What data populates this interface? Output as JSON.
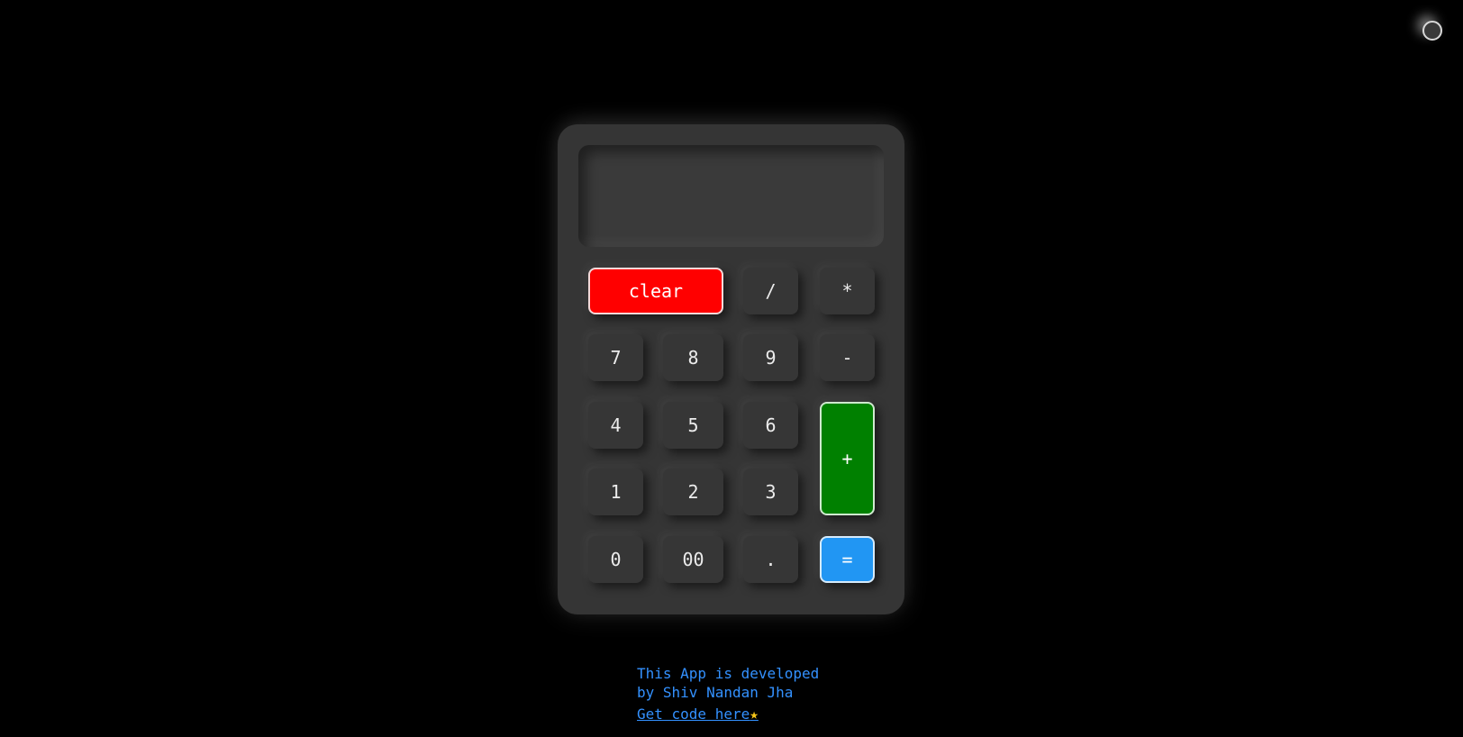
{
  "display": {
    "value": ""
  },
  "keys": {
    "clear": "clear",
    "divide": "/",
    "multiply": "*",
    "seven": "7",
    "eight": "8",
    "nine": "9",
    "minus": "-",
    "four": "4",
    "five": "5",
    "six": "6",
    "plus": "+",
    "one": "1",
    "two": "2",
    "three": "3",
    "zero": "0",
    "double_zero": "00",
    "dot": ".",
    "equals": "="
  },
  "credit": {
    "line1": "This App is developed",
    "line2": "by Shiv Nandan Jha",
    "link_text": "Get code here",
    "link_icon": "★"
  },
  "colors": {
    "background": "#000000",
    "calculator_body": "#353535",
    "clear_key": "#ff0000",
    "plus_key": "#008000",
    "equals_key": "#2196f3",
    "credit_text": "#3391ff"
  },
  "icons": {
    "theme_toggle": "circle-toggle-icon",
    "link_star": "star-icon"
  }
}
